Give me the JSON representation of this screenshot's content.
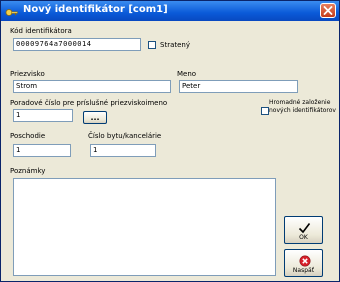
{
  "window": {
    "title": "Nový identifikátor [com1]"
  },
  "form": {
    "id_code_label": "Kód identifikátora",
    "id_code_value": "00009764a7000014",
    "lost_label": "Stratený",
    "lost_checked": false,
    "surname_label": "Priezvisko",
    "surname_value": "Strom",
    "name_label": "Meno",
    "name_value": "Peter",
    "order_label": "Poradové číslo pre príslušné priezviskoimeno",
    "order_value": "1",
    "order_button_label": "...",
    "bulk_label": "Hromadné založenie nových identifikátorov",
    "bulk_checked": false,
    "floor_label": "Poschodie",
    "floor_value": "1",
    "office_label": "Číslo bytu/kancelárie",
    "office_value": "1",
    "notes_label": "Poznámky",
    "notes_value": ""
  },
  "buttons": {
    "ok_label": "OK",
    "back_label": "Naspäť"
  },
  "icons": {
    "title_icon": "key-icon",
    "ok_icon": "checkmark-icon",
    "back_icon": "cancel-icon"
  },
  "colors": {
    "titlebar": "#0a5ad8",
    "close": "#c33a1a",
    "dialog_bg": "#ece9d8",
    "field_border": "#7f9db9"
  }
}
